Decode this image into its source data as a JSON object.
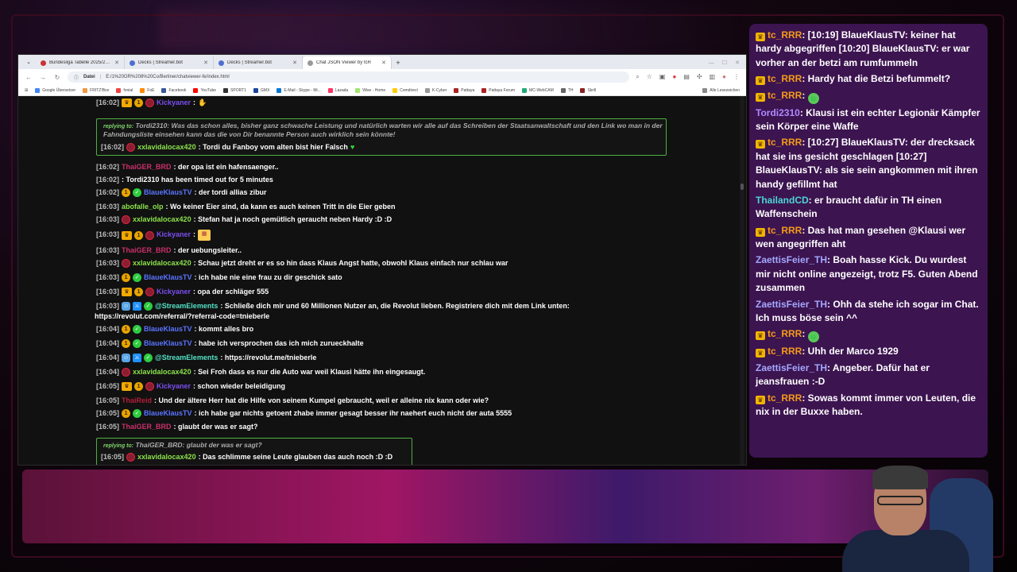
{
  "browser": {
    "tabs": [
      {
        "label": "Bundesliga Tabelle 2025/2026"
      },
      {
        "label": "Decks | Streamer.bot"
      },
      {
        "label": "Decks | Streamer.bot"
      },
      {
        "label": "Chat JSON Viewer by tcR"
      }
    ],
    "new_tab": "+",
    "address_label": "Datei",
    "url": "E:/1%20OR%208%20Co/Berliner/chatviewer-fe/index.html",
    "bookmarks": [
      "Google Übersetzer",
      "FRITZ!Box",
      "fonial",
      "FoE",
      "Facebook",
      "YouTube",
      "SPORT1",
      "GMX",
      "E-Mail - Skype - Mi...",
      "Lazada",
      "Wise - Home",
      "Comdirect",
      "K-Cyber",
      "Pattaya",
      "Pattaya Forum",
      "MC-WebCAM",
      "TH",
      "Skrill"
    ],
    "bookmarks_right": "Alle Lesezeichen"
  },
  "chat": {
    "top_partial": {
      "ts": "[16:02]",
      "user": "Kickyaner",
      "sep": ":"
    },
    "reply1": {
      "label": "replying to:",
      "text": "Tordi2310: Was das schon alles, bisher ganz schwache Leistung und natürlich warten wir alle auf das Schreiben der Staatsanwaltschaft und den Link wo man in der Fahndungsliste einsehen kann das die von Dir benannte Person auch wirklich sein könnte!",
      "ts": "[16:02]",
      "user": "xxlavidalocax420",
      "msg": ": Tordi du Fanboy vom alten bist hier Falsch"
    },
    "lines": [
      {
        "ts": "[16:02]",
        "user": "ThaiGER_BRD",
        "msg": ": der opa ist ein hafensaenger.."
      },
      {
        "ts": "[16:02]",
        "user": "",
        "msg": ": Tordi2310 has been timed out for 5 minutes"
      },
      {
        "ts": "[16:02]",
        "user": "BlaueKlausTV",
        "msg": ": der tordi allias zibur"
      },
      {
        "ts": "[16:03]",
        "user": "abofalle_olp",
        "msg": ": Wo keiner Eier sind, da kann es auch keinen Tritt in die Eier geben"
      },
      {
        "ts": "[16:03]",
        "user": "xxlavidalocax420",
        "msg": ": Stefan hat ja noch gemütlich geraucht neben Hardy :D :D"
      },
      {
        "ts": "[16:03]",
        "user": "Kickyaner",
        "msg": ":"
      },
      {
        "ts": "[16:03]",
        "user": "ThaiGER_BRD",
        "msg": ": der uebungsleiter.."
      },
      {
        "ts": "[16:03]",
        "user": "xxlavidalocax420",
        "msg": ": Schau jetzt dreht er es so hin dass Klaus Angst hatte, obwohl Klaus einfach nur schlau war"
      },
      {
        "ts": "[16:03]",
        "user": "BlaueKlausTV",
        "msg": ": ich habe nie eine frau zu dir geschick sato"
      },
      {
        "ts": "[16:03]",
        "user": "Kickyaner",
        "msg": ": opa der schläger 555"
      },
      {
        "ts": "[16:03]",
        "user": "@StreamElements",
        "msg": ": Schließe dich mir und 60 Millionen Nutzer an, die Revolut lieben. Registriere dich mit dem Link unten:"
      },
      {
        "ts": "",
        "user": "",
        "msg": "https://revolut.com/referral/?referral-code=tnieberle"
      },
      {
        "ts": "[16:04]",
        "user": "BlaueKlausTV",
        "msg": ": kommt alles bro"
      },
      {
        "ts": "[16:04]",
        "user": "BlaueKlausTV",
        "msg": ": habe ich versprochen das ich mich zurueckhalte"
      },
      {
        "ts": "[16:04]",
        "user": "@StreamElements",
        "msg": ": https://revolut.me/tnieberle"
      },
      {
        "ts": "[16:04]",
        "user": "xxlavidalocax420",
        "msg": ": Sei Froh dass es nur die Auto war weil Klausi hätte ihn eingesaugt."
      },
      {
        "ts": "[16:05]",
        "user": "Kickyaner",
        "msg": ": schon wieder beleidigung"
      },
      {
        "ts": "[16:05]",
        "user": "ThaiReid",
        "msg": ": Und der ältere Herr hat die Hilfe von seinem Kumpel gebraucht, weil er alleine nix kann oder wie?"
      },
      {
        "ts": "[16:05]",
        "user": "BlaueKlausTV",
        "msg": ": ich habe gar nichts getoent zhabe immer gesagt besser ihr naehert euch nicht der auta 5555"
      },
      {
        "ts": "[16:05]",
        "user": "ThaiGER_BRD",
        "msg": ": glaubt der was er sagt?"
      }
    ],
    "reply2": {
      "label": "replying to:",
      "text": "ThaiGER_BRD: glaubt der was er sagt?",
      "ts": "[16:05]",
      "user": "xxlavidalocax420",
      "msg": ": Das schlimme seine Leute glauben das auch noch :D :D"
    }
  },
  "side_chat": [
    {
      "user": "tc_RRR",
      "msg": ": [10:19] BlaueKlausTV: keiner hat hardy abgegriffen [10:20] BlaueKlausTV: er war vorher an der betzi am rumfummeln",
      "crown": true
    },
    {
      "user": "tc_RRR",
      "msg": ": Hardy hat die Betzi befummelt?",
      "crown": true
    },
    {
      "user": "tc_RRR",
      "msg": ":",
      "crown": true,
      "emote": true
    },
    {
      "user": "Tordi2310",
      "msg": ": Klausi ist ein echter Legionär Kämpfer sein Körper eine Waffe",
      "crown": false
    },
    {
      "user": "tc_RRR",
      "msg": ": [10:27] BlaueKlausTV: der drecksack hat sie ins gesicht geschlagen [10:27] BlaueKlausTV: als sie sein angkommen mit ihren handy gefillmt hat",
      "crown": true
    },
    {
      "user": "ThailandCD",
      "msg": ": er braucht dafür in TH einen Waffenschein",
      "crown": false
    },
    {
      "user": "tc_RRR",
      "msg": ": Das hat man gesehen @Klausi wer wen angegriffen aht",
      "crown": true
    },
    {
      "user": "ZaettisFeier_TH",
      "msg": ": Boah hasse Kick. Du wurdest mir nicht online angezeigt, trotz F5. Guten Abend zusammen",
      "crown": false
    },
    {
      "user": "ZaettisFeier_TH",
      "msg": ": Ohh da stehe ich sogar im Chat. Ich muss böse sein ^^",
      "crown": false
    },
    {
      "user": "tc_RRR",
      "msg": ":",
      "crown": true,
      "emote": true
    },
    {
      "user": "tc_RRR",
      "msg": ": Uhh der Marco 1929",
      "crown": true
    },
    {
      "user": "ZaettisFeier_TH",
      "msg": ": Angeber. Dafür hat er jeansfrauen :-D",
      "crown": false
    },
    {
      "user": "tc_RRR",
      "msg": ": Sowas kommt immer von Leuten, die nix in der Buxxe haben.",
      "crown": true
    }
  ],
  "colors": {
    "side_bg": "#3c1450",
    "user_orange": "#f49b1a",
    "reply_border": "#4db040"
  }
}
